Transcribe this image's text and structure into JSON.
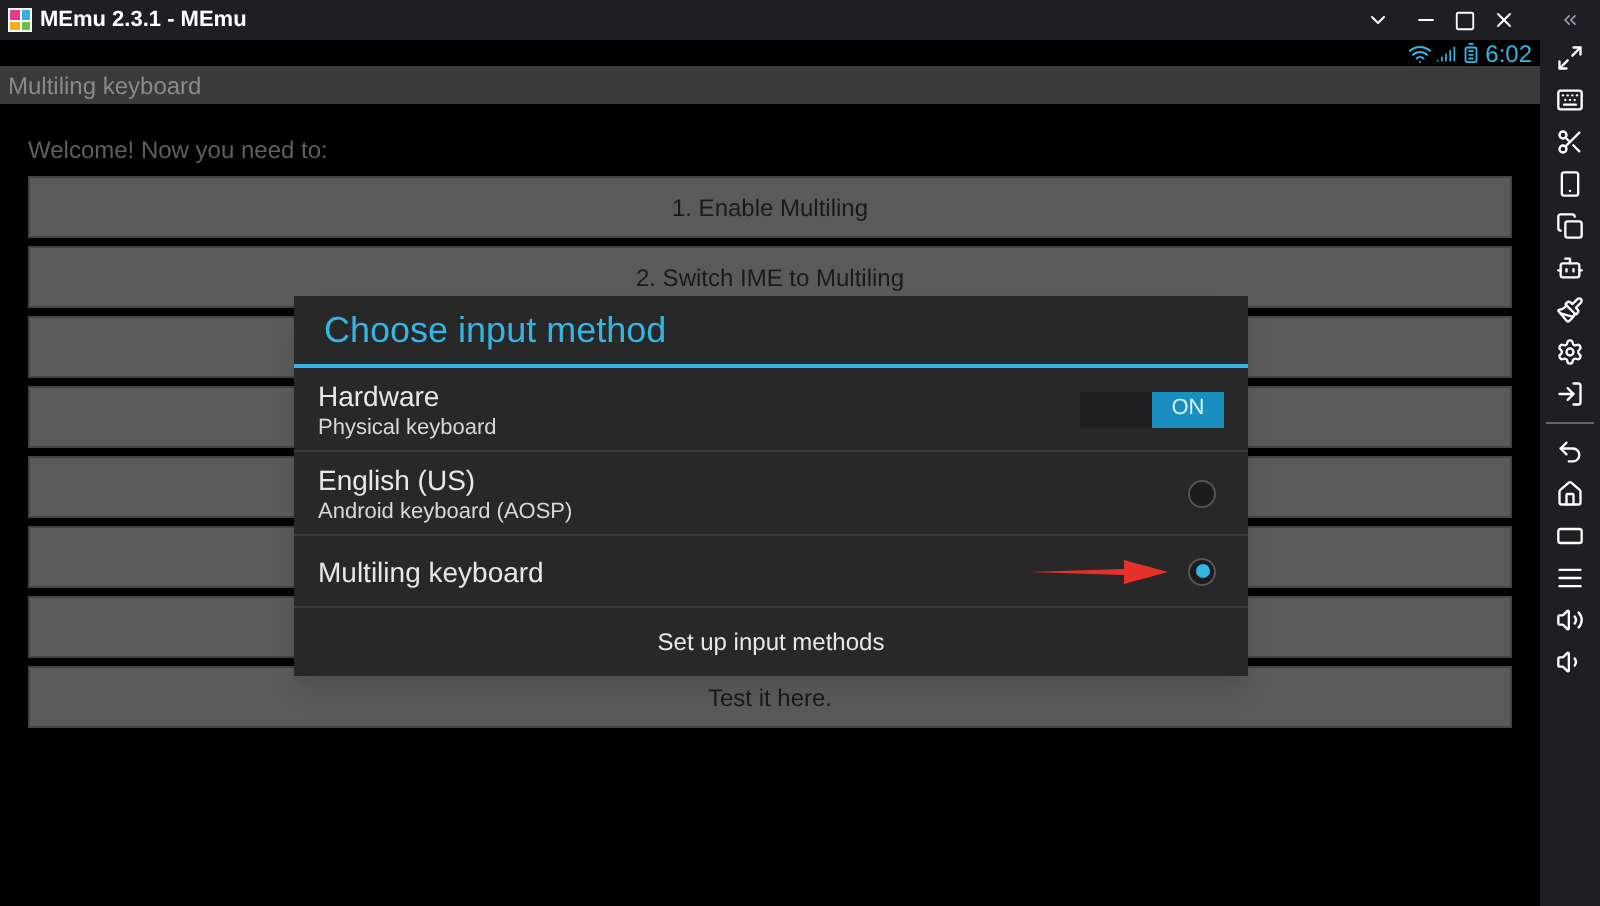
{
  "window": {
    "title": "MEmu 2.3.1 - MEmu"
  },
  "status_bar": {
    "time": "6:02"
  },
  "app": {
    "title": "Multiling keyboard",
    "intro": "Welcome! Now you need to:",
    "buttons": [
      {
        "kind": "labelled",
        "label": "1. Enable Multiling"
      },
      {
        "kind": "labelled",
        "label": "2. Switch IME to Multiling"
      },
      {
        "kind": "covered"
      },
      {
        "kind": "covered"
      },
      {
        "kind": "covered"
      },
      {
        "kind": "covered"
      },
      {
        "kind": "covered"
      },
      {
        "kind": "labelled",
        "label": "Test it here."
      }
    ]
  },
  "dialog": {
    "title": "Choose input method",
    "items": [
      {
        "kind": "toggle",
        "title": "Hardware",
        "subtitle": "Physical keyboard",
        "on": true,
        "toggle_label": "ON"
      },
      {
        "kind": "radio",
        "title": "English (US)",
        "subtitle": "Android keyboard (AOSP)",
        "selected": false
      },
      {
        "kind": "radio",
        "title": "Multiling keyboard",
        "selected": true
      }
    ],
    "footer": "Set up input methods"
  }
}
